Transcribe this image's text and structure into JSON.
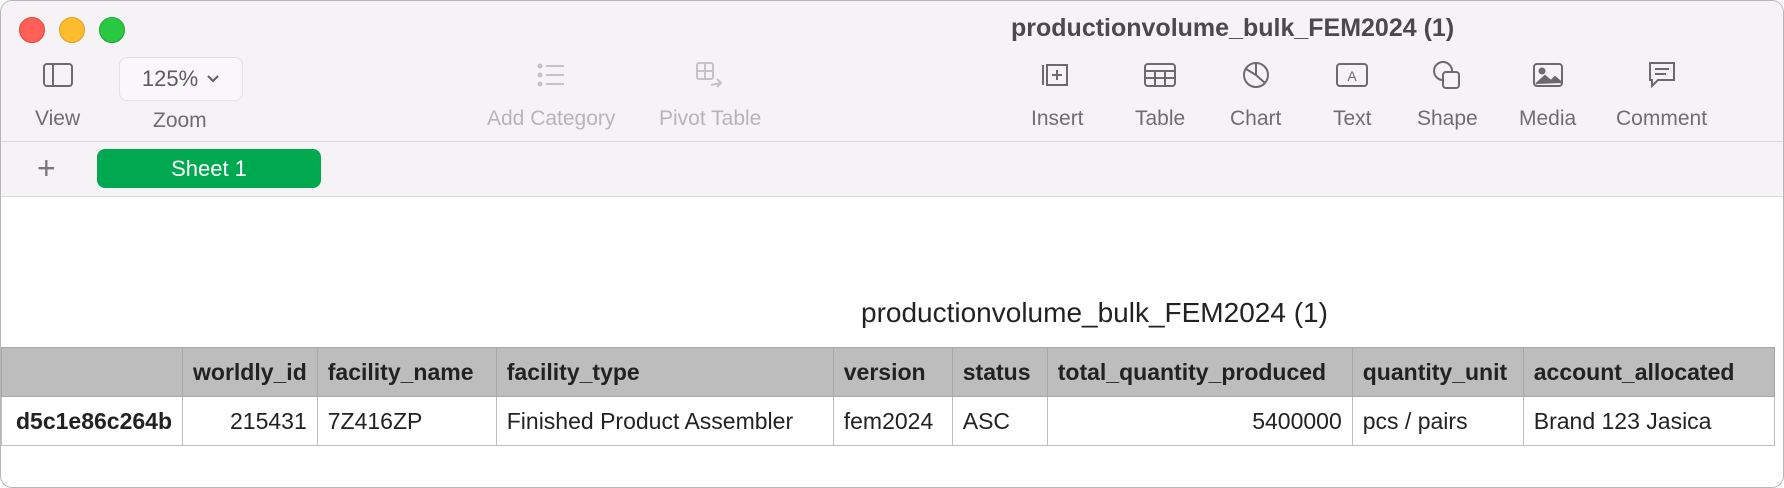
{
  "window": {
    "title": "productionvolume_bulk_FEM2024 (1)"
  },
  "toolbar": {
    "view_label": "View",
    "zoom_value": "125%",
    "zoom_label": "Zoom",
    "add_category_label": "Add Category",
    "pivot_table_label": "Pivot Table",
    "insert_label": "Insert",
    "table_label": "Table",
    "chart_label": "Chart",
    "text_label": "Text",
    "shape_label": "Shape",
    "media_label": "Media",
    "comment_label": "Comment"
  },
  "sheets": {
    "add_symbol": "+",
    "tabs": [
      {
        "label": "Sheet 1"
      }
    ]
  },
  "table": {
    "title": "productionvolume_bulk_FEM2024 (1)",
    "columns": [
      "",
      "worldly_id",
      "facility_name",
      "facility_type",
      "version",
      "status",
      "total_quantity_produced",
      "quantity_unit",
      "account_allocated"
    ],
    "rows": [
      [
        "d5c1e86c264b",
        "215431",
        "7Z416ZP",
        "Finished Product Assembler",
        "fem2024",
        "ASC",
        "5400000",
        "pcs / pairs",
        "Brand 123 Jasica"
      ]
    ]
  },
  "colors": {
    "accent": "#00a94f",
    "status_highlight": "#f28b8b",
    "header_bg": "#bdbdbd"
  }
}
